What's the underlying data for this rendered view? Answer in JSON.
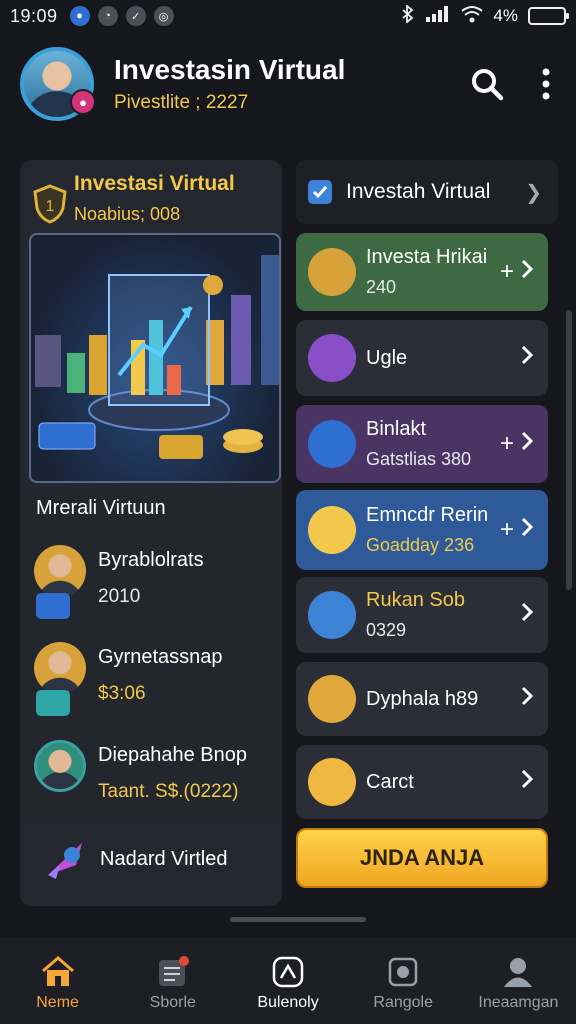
{
  "status_bar": {
    "time": "19:09",
    "battery": "4%"
  },
  "header": {
    "title": "Investasin Virtual",
    "subtitle": "Pivestlite ; 2227"
  },
  "left_panel": {
    "title": "Investasi Virtual",
    "subtitle": "Noabius; 008",
    "list_title": "Mrerali Virtuun",
    "items": [
      {
        "name": "Byrablolrats",
        "value": "2010",
        "value_color": "#e8e8e8"
      },
      {
        "name": "Gyrnetassnap",
        "value": "$3:06",
        "value_color": "#f2c94c"
      },
      {
        "name": "Diepahahe Bnop",
        "value": "Taant. S$.(0222)",
        "value_color": "#f2c94c"
      }
    ],
    "footer_item": "Nadard Virtled"
  },
  "right_panel": {
    "header_label": "Investah Virtual",
    "rows": [
      {
        "title": "Investa Hrikai",
        "sub": "240",
        "bg": "#3d6a43",
        "sub_color": "#e8e8e8",
        "plus": true,
        "icon": "avatar-icon"
      },
      {
        "title": "Ugle",
        "sub": "",
        "bg": "#2b2e36",
        "sub_color": "#e8e8e8",
        "plus": false,
        "icon": "chat-icon"
      },
      {
        "title": "Binlakt",
        "sub": "Gatstlias 380",
        "bg": "#4a3464",
        "sub_color": "#e8e8e8",
        "plus": true,
        "icon": "coin-icon"
      },
      {
        "title": "Emncdr Rerin",
        "sub": "Goadday 236",
        "bg": "#2e5a9a",
        "sub_color": "#f2c94c",
        "plus": true,
        "icon": "key-icon"
      },
      {
        "title": "Rukan Sob",
        "sub": "0329",
        "bg": "#2b2e36",
        "sub_color": "#e8e8e8",
        "plus": false,
        "icon": "box-icon",
        "title_color": "#f2c94c"
      },
      {
        "title": "Dyphala h89",
        "sub": "",
        "bg": "#2b2e36",
        "sub_color": "#e8e8e8",
        "plus": false,
        "icon": "badge-icon"
      },
      {
        "title": "Carct",
        "sub": "",
        "bg": "#2b2e36",
        "sub_color": "#e8e8e8",
        "plus": false,
        "icon": "trophy-icon"
      }
    ],
    "cta_label": "JNDA ANJA"
  },
  "bottom_nav": [
    {
      "label": "Neme",
      "icon": "home-icon",
      "active": true
    },
    {
      "label": "Sborle",
      "icon": "list-icon",
      "active": false
    },
    {
      "label": "Bulenoly",
      "icon": "shield-icon",
      "active": false
    },
    {
      "label": "Rangole",
      "icon": "frame-icon",
      "active": false
    },
    {
      "label": "Ineaamgan",
      "icon": "person-icon",
      "active": false
    }
  ],
  "colors": {
    "accent": "#f4a63a",
    "gold": "#f2c94c",
    "background": "#15171d",
    "panel": "#24272f"
  }
}
